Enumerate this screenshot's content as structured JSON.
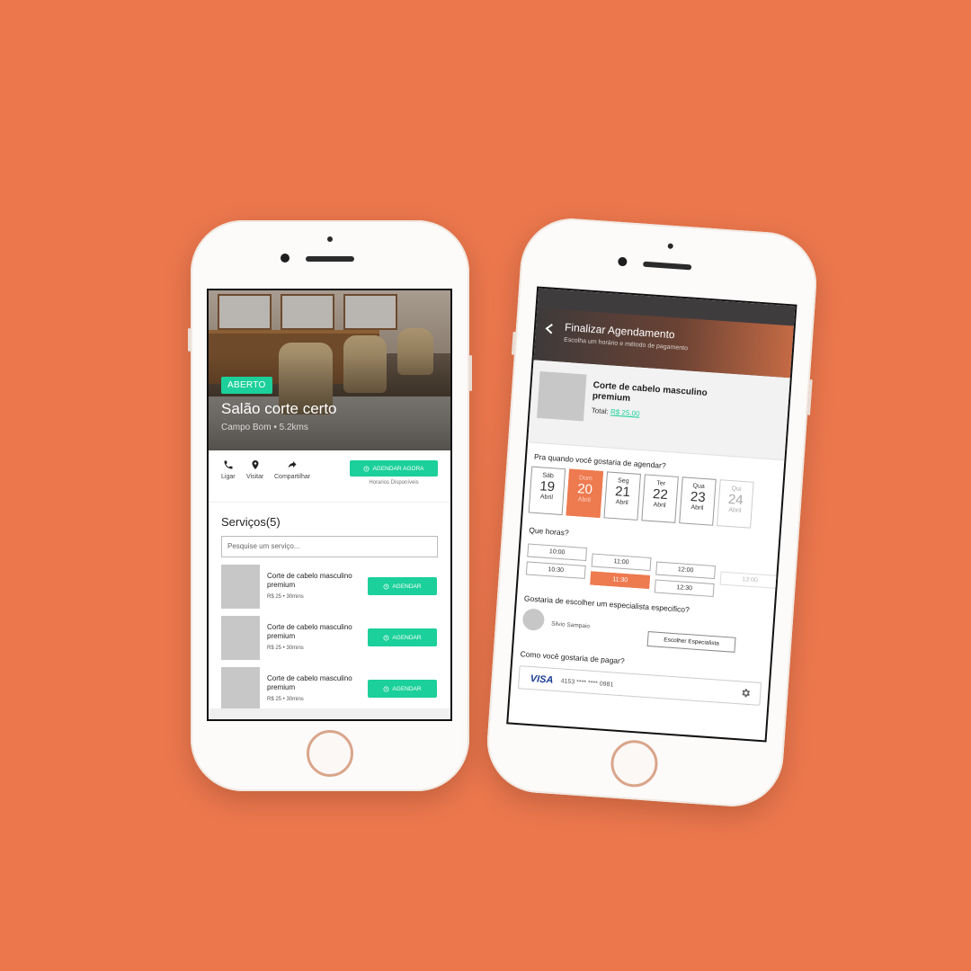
{
  "colors": {
    "background": "#EC774D",
    "accent_green": "#1BD09A",
    "accent_orange": "#EE7A4F"
  },
  "left_screen": {
    "status_badge": "ABERTO",
    "shop_name": "Salão corte certo",
    "shop_location": "Campo Bom • 5.2kms",
    "actions": [
      {
        "label": "Ligar",
        "icon": "phone-icon"
      },
      {
        "label": "Visitar",
        "icon": "location-pin-icon"
      },
      {
        "label": "Compartilhar",
        "icon": "share-icon"
      }
    ],
    "book_now_label": "AGENDAR AGORA",
    "available_hours_label": "Horarios Disponíveis",
    "services_title": "Serviços(5)",
    "search_placeholder": "Pesquise um serviço...",
    "services": [
      {
        "name": "Corte de cabelo masculino premium",
        "meta": "R$ 25 • 30mins",
        "button": "AGENDAR"
      },
      {
        "name": "Corte de cabelo masculino premium",
        "meta": "R$ 25 • 30mins",
        "button": "AGENDAR"
      },
      {
        "name": "Corte de cabelo masculino premium",
        "meta": "R$ 25 • 30mins",
        "button": "AGENDAR"
      }
    ]
  },
  "right_screen": {
    "header_title": "Finalizar Agendamento",
    "header_subtitle": "Escolha um horário e método de pagamento",
    "product_name": "Corte de cabelo masculino premium",
    "total_label": "Total:",
    "total_value": "R$ 25,00",
    "date_question": "Pra quando você gostaria de agendar?",
    "dates": [
      {
        "weekday": "Sáb",
        "day": "19",
        "month": "Abril",
        "state": "normal"
      },
      {
        "weekday": "Dom",
        "day": "20",
        "month": "Abril",
        "state": "selected"
      },
      {
        "weekday": "Seg",
        "day": "21",
        "month": "Abril",
        "state": "normal"
      },
      {
        "weekday": "Ter",
        "day": "22",
        "month": "Abril",
        "state": "normal"
      },
      {
        "weekday": "Qua",
        "day": "23",
        "month": "Abril",
        "state": "normal"
      },
      {
        "weekday": "Qui",
        "day": "24",
        "month": "Abril",
        "state": "dim"
      }
    ],
    "time_question": "Que horas?",
    "times": [
      {
        "label": "10:00",
        "state": "normal"
      },
      {
        "label": "11:00",
        "state": "normal"
      },
      {
        "label": "10:30",
        "state": "normal"
      },
      {
        "label": "11:30",
        "state": "selected"
      },
      {
        "label": "12:00",
        "state": "normal"
      },
      {
        "label": "12:30",
        "state": "normal"
      },
      {
        "label": "13:00",
        "state": "dim"
      }
    ],
    "specialist_question": "Gostaria de escolher um especialista especifico?",
    "specialist_name": "Silvio Sampaio",
    "choose_specialist_label": "Escolher Especialista",
    "payment_question": "Como você gostaria de pagar?",
    "card_brand": "VISA",
    "card_number": "4153 **** **** 0981"
  }
}
